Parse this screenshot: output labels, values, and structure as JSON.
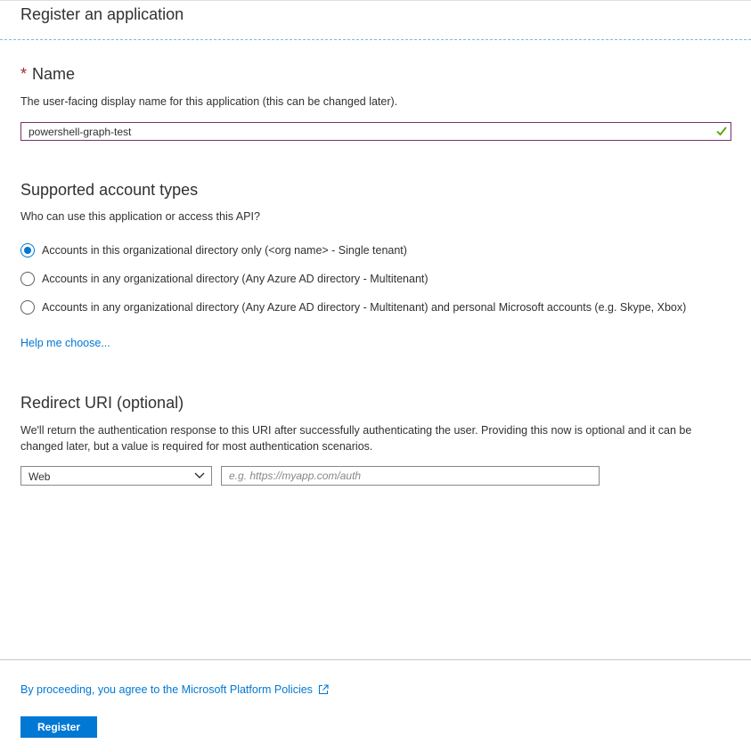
{
  "header": {
    "title": "Register an application"
  },
  "name_section": {
    "required_mark": "*",
    "title": "Name",
    "description": "The user-facing display name for this application (this can be changed later).",
    "value": "powershell-graph-test",
    "valid_icon": "checkmark-icon"
  },
  "account_types": {
    "title": "Supported account types",
    "description": "Who can use this application or access this API?",
    "options": [
      {
        "label": "Accounts in this organizational directory only (<org name> - Single tenant)",
        "selected": true
      },
      {
        "label": "Accounts in any organizational directory (Any Azure AD directory - Multitenant)",
        "selected": false
      },
      {
        "label": "Accounts in any organizational directory (Any Azure AD directory - Multitenant) and personal Microsoft accounts (e.g. Skype, Xbox)",
        "selected": false
      }
    ],
    "help_link": "Help me choose..."
  },
  "redirect": {
    "title": "Redirect URI (optional)",
    "description": "We'll return the authentication response to this URI after successfully authenticating the user. Providing this now is optional and it can be changed later, but a value is required for most authentication scenarios.",
    "platform_value": "Web",
    "uri_placeholder": "e.g. https://myapp.com/auth",
    "uri_value": ""
  },
  "footer": {
    "policy_link": "By proceeding, you agree to the Microsoft Platform Policies",
    "register_label": "Register"
  },
  "colors": {
    "accent": "#0078d4",
    "required": "#a4262c",
    "valid": "#57a300",
    "focus_border": "#7a306b"
  }
}
